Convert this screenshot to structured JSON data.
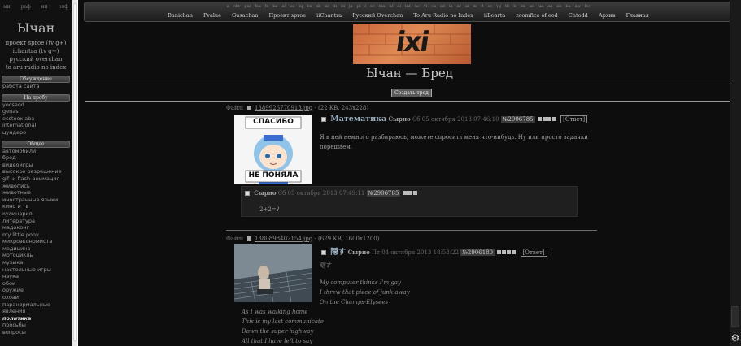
{
  "sidebar": {
    "top_links": [
      "ми",
      "рaф",
      "ни",
      "ряф"
    ],
    "title": "Ычан",
    "projects": [
      "проект sproe (tv g+)",
      "ichantra (tv g+)",
      "русский overchan",
      "to aru radio no index"
    ],
    "section_discussion": "Обсуждение",
    "discussion_items": [
      "работа сайта"
    ],
    "section_trial": "На пробу",
    "trial_items": [
      "yocseod",
      "genas",
      "ecsteox aba",
      "international",
      "цундеро"
    ],
    "section_general": "Общее",
    "general_items": [
      "автомобили",
      "бред",
      "видеоигры",
      "высокое разрешение",
      "gif- и flash-анимация",
      "живопись",
      "животные",
      "иностранные языки",
      "кино и тв",
      "кулинария",
      "литература",
      "мадоконг",
      "my little pony",
      "микроэкономиста",
      "медицина",
      "мотоциклы",
      "музыка",
      "настольные игры",
      "наука",
      "обои",
      "оружие",
      "охоаи",
      "паранормальные",
      "явления",
      "политика",
      "просьбы",
      "вопросы"
    ],
    "bold_item": "политика"
  },
  "topbar": {
    "tiny_links": [
      "а",
      "cbr",
      "gui",
      "fsk",
      "fs",
      "ba",
      "ai",
      "bd",
      "iq",
      "bu",
      "sh",
      "ai",
      "th",
      "bi",
      "ja",
      "pl",
      "i",
      "so",
      "ma",
      "nf",
      "ai",
      "int",
      "nc",
      "vi",
      "ca",
      "zd",
      "ia",
      "ar",
      "ai",
      "m",
      "d",
      "se",
      "vg",
      "th",
      "b",
      "bn",
      "an",
      "ua",
      "aa",
      "ab",
      "ba",
      "aw",
      "bo"
    ],
    "main_links": [
      "Banichan",
      "Pvalue",
      "Gusachan",
      "Проект sproe",
      "iiChantra",
      "Русский Overchan",
      "To Aru Radio no Index",
      "iiBoarta",
      "zoomfice of eod",
      "Chtodd",
      "Архив",
      "Главная"
    ]
  },
  "banner_text": "ixi",
  "board_title": "Ычан — Бред",
  "new_thread_label": "Создать тред",
  "threads": [
    {
      "file_label": "Файл:",
      "file_name": "1389926770913.jpg",
      "file_meta": "- (22 KB, 243x228)",
      "thumb_top_text": "СПАСИБО",
      "thumb_bottom_text": "НЕ ПОНЯЛА",
      "subject": "Математика",
      "poster": "Сырно",
      "date": "Сб 05 октября 2013 07:46:10",
      "post_number": "№2906785",
      "reply_label": "Ответ",
      "message": "Я в ней немного разбираюсь, можете спросить меня что-нибудь. Ну или просто задачки порешаем.",
      "reply": {
        "poster": "Сырно",
        "date": "Сб 05 октября 2013 07:49:11",
        "post_number": "№2906785",
        "message": "2+2=?"
      }
    },
    {
      "file_label": "Файл:",
      "file_name": "1380898402154.jpg",
      "file_meta": "- (629 KB, 1600x1200)",
      "subject": "隠す",
      "poster": "Сырно",
      "date": "Пт 04 октября 2013 18:58:22",
      "post_number": "№2906180",
      "reply_label": "Ответ",
      "message_title": "隠す",
      "poem_lines_1": [
        "My computer thinks I'm gay",
        "I threw that piece of junk away",
        "On the Champs-Elysees"
      ],
      "poem_lines_2": [
        "As I was walking home",
        "This is my last communicate",
        "Down the super highway",
        "All that I have left to say"
      ]
    }
  ],
  "colors": {
    "page_bg": "#0d0d0d",
    "sidebar_bg": "#111111",
    "subject": "#9bb0c0",
    "banner": "#d97a48"
  }
}
